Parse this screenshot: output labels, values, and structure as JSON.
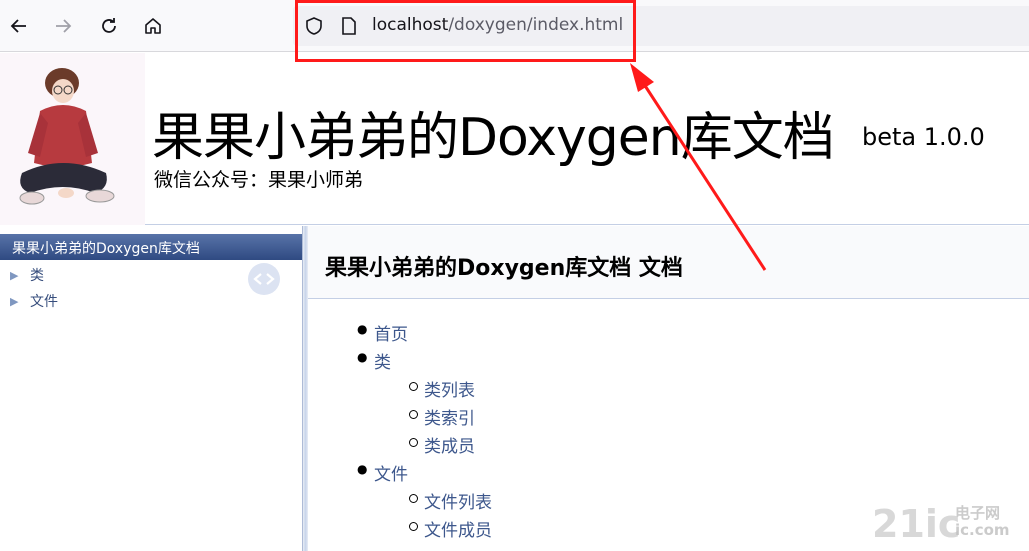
{
  "browser": {
    "url_host": "localhost",
    "url_path": "/doxygen/index.html"
  },
  "header": {
    "project_name": "果果小弟弟的Doxygen库文档",
    "project_number": "beta 1.0.0",
    "project_brief": "微信公众号：果果小师弟"
  },
  "sidenav": {
    "top_item": "果果小弟弟的Doxygen库文档",
    "items": [
      {
        "label": "类"
      },
      {
        "label": "文件"
      }
    ]
  },
  "content": {
    "title": "果果小弟弟的Doxygen库文档 文档",
    "list": {
      "home": "首页",
      "classes": "类",
      "class_list": "类列表",
      "class_index": "类索引",
      "class_members": "类成员",
      "files": "文件",
      "file_list": "文件列表",
      "file_members": "文件成员"
    }
  },
  "watermark": {
    "brand": "21ic",
    "line1": "电子网",
    "line2": "ic.com"
  },
  "colors": {
    "annotation": "#ff1a1a",
    "link": "#3d578c",
    "nav_top": "#2f4a82"
  }
}
